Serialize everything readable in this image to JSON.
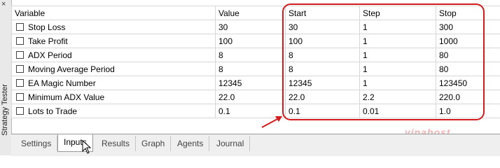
{
  "panel": {
    "title": "Strategy Tester",
    "close_glyph": "×"
  },
  "table": {
    "headers": [
      "Variable",
      "Value",
      "Start",
      "Step",
      "Stop"
    ],
    "rows": [
      {
        "name": "Stop Loss",
        "value": "30",
        "start": "30",
        "step": "1",
        "stop": "300"
      },
      {
        "name": "Take Profit",
        "value": "100",
        "start": "100",
        "step": "1",
        "stop": "1000"
      },
      {
        "name": "ADX Period",
        "value": "8",
        "start": "8",
        "step": "1",
        "stop": "80"
      },
      {
        "name": "Moving Average Period",
        "value": "8",
        "start": "8",
        "step": "1",
        "stop": "80"
      },
      {
        "name": "EA Magic Number",
        "value": "12345",
        "start": "12345",
        "step": "1",
        "stop": "123450"
      },
      {
        "name": "Minimum ADX Value",
        "value": "22.0",
        "start": "22.0",
        "step": "2.2",
        "stop": "220.0"
      },
      {
        "name": "Lots to Trade",
        "value": "0.1",
        "start": "0.1",
        "step": "0.01",
        "stop": "1.0"
      }
    ]
  },
  "tabs": [
    "Settings",
    "Inputs",
    "Results",
    "Graph",
    "Agents",
    "Journal"
  ],
  "active_tab": "Inputs",
  "watermark": "vinahost",
  "colors": {
    "highlight": "#d41b1b",
    "watermark": "#f1b3b3"
  }
}
